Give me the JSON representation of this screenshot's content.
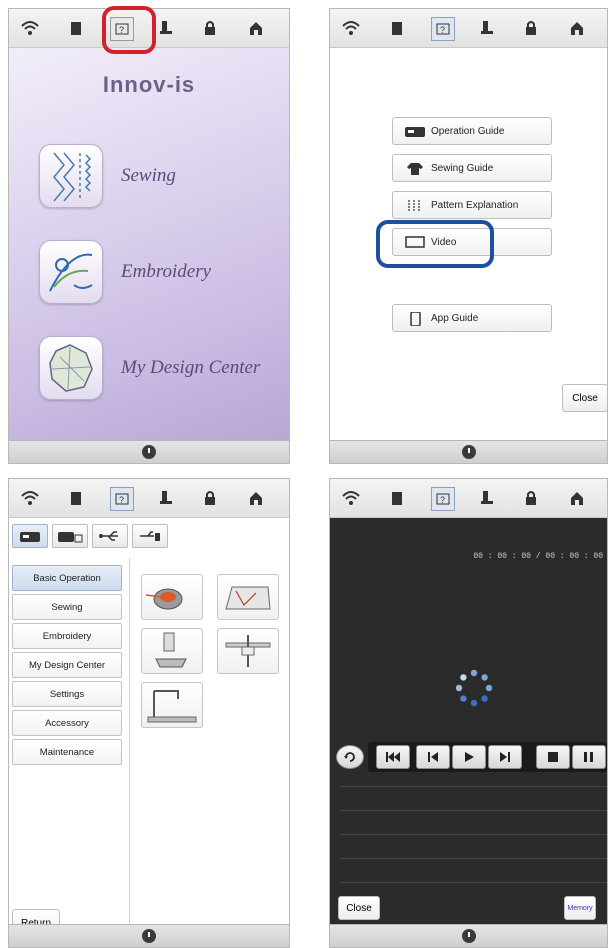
{
  "panels": {
    "home": {
      "brand": "Innov-is",
      "items": [
        {
          "label": "Sewing",
          "icon": "sewing-stitch-icon"
        },
        {
          "label": "Embroidery",
          "icon": "embroidery-design-icon"
        },
        {
          "label": "My Design Center",
          "icon": "my-design-center-icon"
        }
      ]
    },
    "help_menu": {
      "buttons": [
        {
          "label": "Operation Guide",
          "icon": "sewing-machine-icon"
        },
        {
          "label": "Sewing Guide",
          "icon": "shirt-icon"
        },
        {
          "label": "Pattern Explanation",
          "icon": "stitch-pattern-icon"
        },
        {
          "label": "Video",
          "icon": "video-frame-icon"
        },
        {
          "label": "App Guide",
          "icon": "tablet-icon"
        }
      ],
      "close_label": "Close"
    },
    "operation_guide": {
      "nav": [
        "Basic Operation",
        "Sewing",
        "Embroidery",
        "My Design Center",
        "Settings",
        "Accessory",
        "Maintenance"
      ],
      "selected": "Basic Operation",
      "return_label": "Return"
    },
    "video": {
      "time": "00 : 00 : 00 / 00 : 00 : 00",
      "close_label": "Close",
      "memory_label": "Memory"
    }
  },
  "colors": {
    "highlight_red": "#d1212a",
    "highlight_blue": "#1c4fa0",
    "memory_text": "#3b2fb5"
  }
}
